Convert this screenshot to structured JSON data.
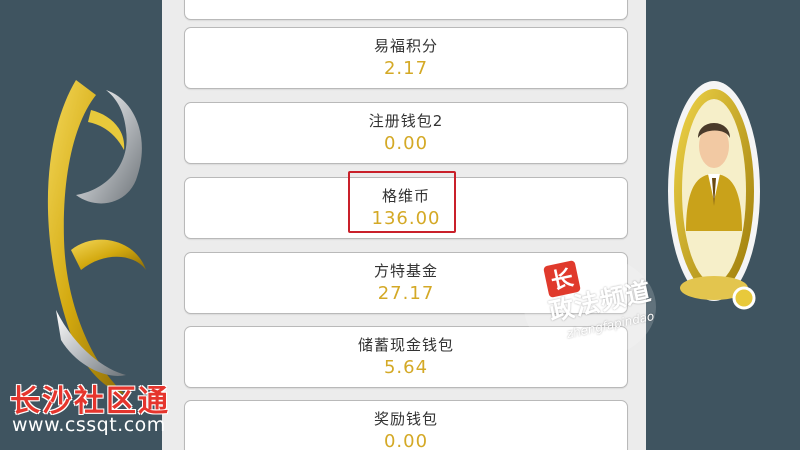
{
  "wallet": {
    "items": [
      {
        "label": "易福积分",
        "value": "2.17"
      },
      {
        "label": "注册钱包2",
        "value": "0.00"
      },
      {
        "label": "格维币",
        "value": "136.00"
      },
      {
        "label": "方特基金",
        "value": "27.17"
      },
      {
        "label": "储蓄现金钱包",
        "value": "5.64"
      },
      {
        "label": "奖励钱包",
        "value": "0.00"
      }
    ]
  },
  "watermark": {
    "channel": "政法频道",
    "channel_pinyin": "zhengfapindao",
    "channel_badge": "长"
  },
  "brand": {
    "name": "长沙社区通",
    "url": "www.cssqt.com"
  },
  "colors": {
    "background": "#3f5460",
    "value_gold": "#d4a926",
    "highlight_red": "#c9202a"
  }
}
